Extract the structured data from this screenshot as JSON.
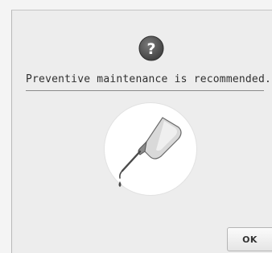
{
  "dialog": {
    "icon": "question-mark-icon",
    "message": "Preventive maintenance is recommended.",
    "illustration": "oil-bottle-icon",
    "ok_label": "OK"
  },
  "colors": {
    "background": "#ededed",
    "text": "#303030",
    "icon_fill": "#555555"
  }
}
